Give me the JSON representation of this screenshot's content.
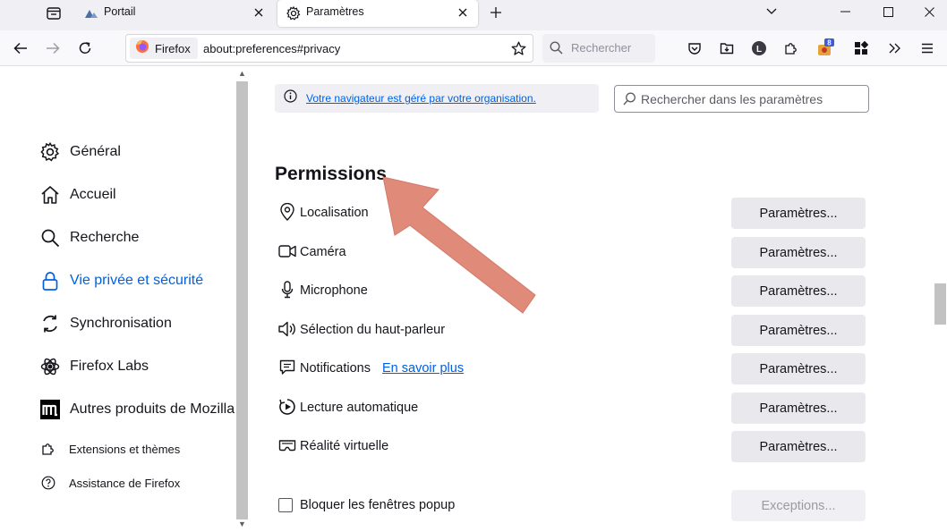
{
  "tabs": [
    {
      "label": "Portail",
      "icon": "portal-icon",
      "active": false
    },
    {
      "label": "Paramètres",
      "icon": "gear-icon",
      "active": true
    }
  ],
  "navbar": {
    "identity_label": "Firefox",
    "url": "about:preferences#privacy",
    "search_placeholder": "Rechercher",
    "extension_badge": "8",
    "account_initial": "L"
  },
  "sidebar": {
    "items": [
      {
        "label": "Général",
        "icon": "gear-icon",
        "selected": false
      },
      {
        "label": "Accueil",
        "icon": "home-icon",
        "selected": false
      },
      {
        "label": "Recherche",
        "icon": "search-icon",
        "selected": false
      },
      {
        "label": "Vie privée et sécurité",
        "icon": "lock-icon",
        "selected": true
      },
      {
        "label": "Synchronisation",
        "icon": "sync-icon",
        "selected": false
      },
      {
        "label": "Firefox Labs",
        "icon": "labs-icon",
        "selected": false
      },
      {
        "label": "Autres produits de Mozilla",
        "icon": "mozilla-m-icon",
        "selected": false
      }
    ],
    "footer": [
      {
        "label": "Extensions et thèmes",
        "icon": "puzzle-icon"
      },
      {
        "label": "Assistance de Firefox",
        "icon": "help-icon"
      }
    ]
  },
  "main": {
    "policy_banner": "Votre navigateur est géré par votre organisation.",
    "settings_search_placeholder": "Rechercher dans les paramètres",
    "section_title": "Permissions",
    "permissions": [
      {
        "label": "Localisation",
        "icon": "location-pin-icon",
        "button": "Paramètres..."
      },
      {
        "label": "Caméra",
        "icon": "camera-icon",
        "button": "Paramètres..."
      },
      {
        "label": "Microphone",
        "icon": "microphone-icon",
        "button": "Paramètres..."
      },
      {
        "label": "Sélection du haut-parleur",
        "icon": "speaker-icon",
        "button": "Paramètres..."
      },
      {
        "label": "Notifications",
        "icon": "notification-icon",
        "button": "Paramètres...",
        "link": "En savoir plus"
      },
      {
        "label": "Lecture automatique",
        "icon": "autoplay-icon",
        "button": "Paramètres..."
      },
      {
        "label": "Réalité virtuelle",
        "icon": "vr-headset-icon",
        "button": "Paramètres..."
      }
    ],
    "popup_row": {
      "label": "Bloquer les fenêtres popup",
      "checked": false,
      "button": "Exceptions..."
    }
  },
  "colors": {
    "accent": "#0061e0",
    "annotation_arrow": "#e08a7a"
  }
}
